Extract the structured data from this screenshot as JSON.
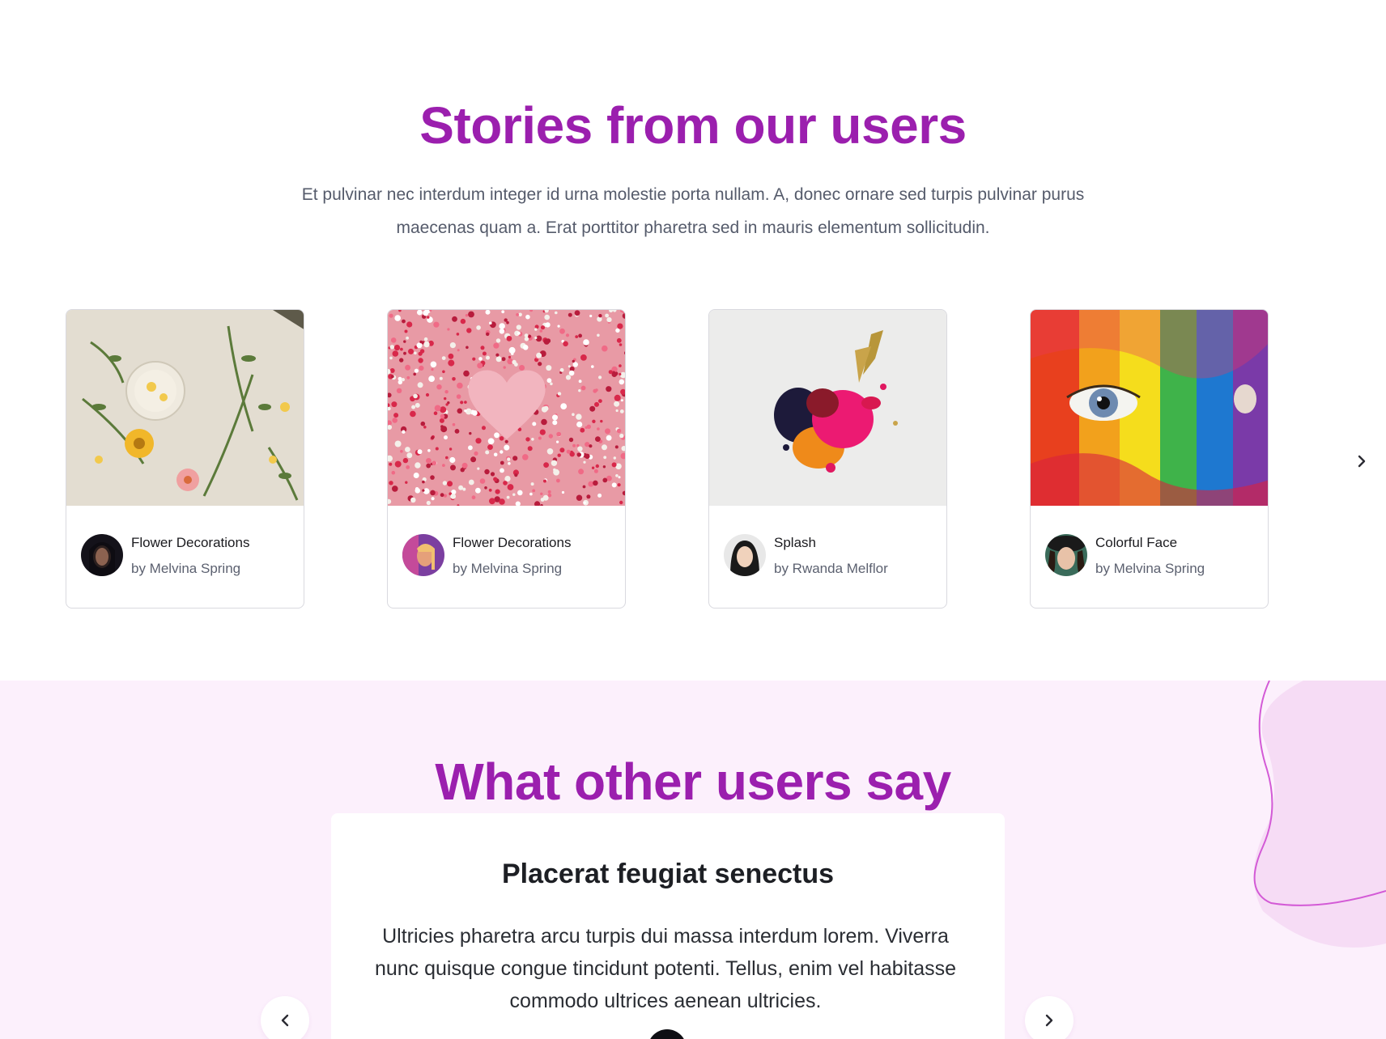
{
  "stories": {
    "title": "Stories from our users",
    "subtitle": "Et pulvinar nec interdum integer id urna molestie porta nullam. A, donec ornare sed turpis pulvinar purus maecenas quam a. Erat porttitor pharetra sed in mauris elementum sollicitudin.",
    "cards": [
      {
        "title": "Flower Decorations",
        "author": "by Melvina Spring"
      },
      {
        "title": "Flower Decorations",
        "author": "by Melvina Spring"
      },
      {
        "title": "Splash",
        "author": "by Rwanda Melflor"
      },
      {
        "title": "Colorful Face",
        "author": "by Melvina Spring"
      }
    ],
    "next_icon": "chevron-right-icon"
  },
  "testimonials": {
    "title": "What other users say",
    "card": {
      "heading": "Placerat feugiat senectus",
      "body": "Ultricies pharetra arcu turpis dui massa interdum lorem. Viverra nunc quisque congue tincidunt potenti. Tellus, enim vel habitasse commodo ultrices aenean ultricies."
    },
    "prev_icon": "chevron-left-icon",
    "next_icon": "chevron-right-icon"
  },
  "colors": {
    "accent": "#9b1fae",
    "section_bg": "#fcf0fc"
  }
}
